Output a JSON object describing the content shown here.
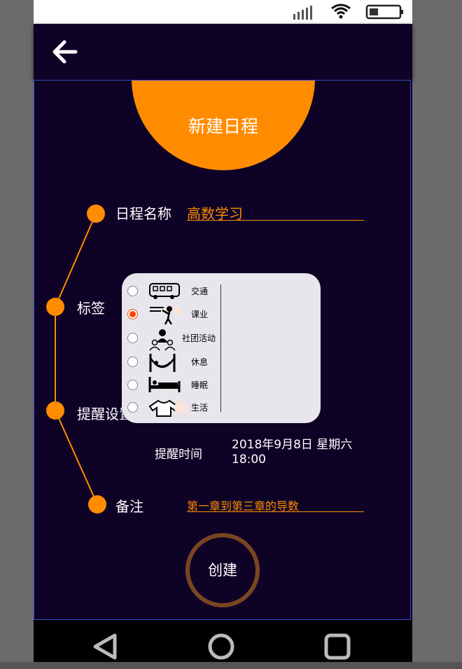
{
  "header": {
    "title": "新建日程"
  },
  "form": {
    "name_label": "日程名称",
    "name_value": "高数学习",
    "tag_label": "标签",
    "tag_value": "课业",
    "reminder_label": "提醒设置",
    "reminder_time_label": "提醒时间",
    "reminder_time_value_line1": "2018年9月8日 星期六",
    "reminder_time_value_line2": "18:00",
    "note_label": "备注",
    "note_value": "第一章到第三章的导数"
  },
  "tag_options": [
    {
      "label": "交通",
      "icon": "bus-icon",
      "selected": false
    },
    {
      "label": "课业",
      "icon": "teacher-icon",
      "selected": true
    },
    {
      "label": "社团活动",
      "icon": "group-icon",
      "selected": false
    },
    {
      "label": "休息",
      "icon": "hammock-icon",
      "selected": false
    },
    {
      "label": "睡眠",
      "icon": "bed-icon",
      "selected": false
    },
    {
      "label": "生活",
      "icon": "shirt-icon",
      "selected": false
    }
  ],
  "actions": {
    "create_label": "创建"
  },
  "colors": {
    "accent": "#ff8c00",
    "background": "#0e0226",
    "popup": "#e8e6ec",
    "button_ring": "#7a4522"
  }
}
